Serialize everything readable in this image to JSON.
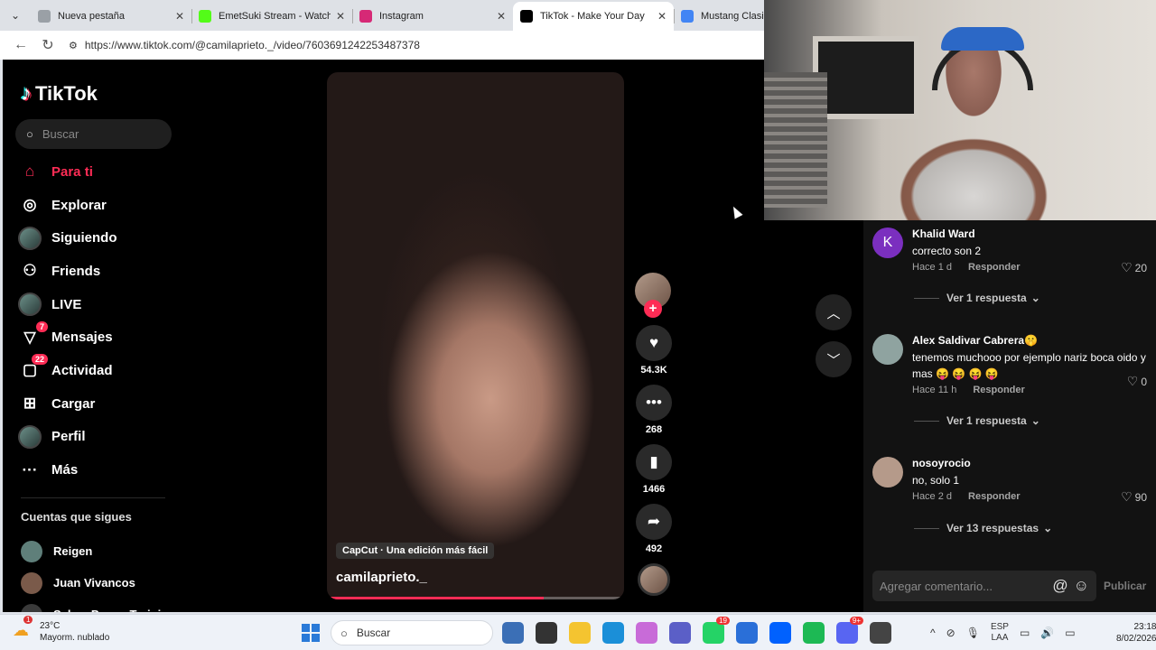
{
  "browser": {
    "tabs": [
      {
        "title": "Nueva pestaña",
        "favicon_color": "#9aa0a6",
        "active": false
      },
      {
        "title": "EmetSuki Stream - Watch Live",
        "favicon_color": "#53fc18",
        "active": false
      },
      {
        "title": "Instagram",
        "favicon_color": "#d62976",
        "active": false
      },
      {
        "title": "TikTok - Make Your Day",
        "favicon_color": "#000000",
        "active": true
      },
      {
        "title": "Mustang Clasico",
        "favicon_color": "#4285f4",
        "active": false
      }
    ],
    "url": "https://www.tiktok.com/@camilaprieto._/video/7603691242253487378"
  },
  "tiktok": {
    "brand": "TikTok",
    "search_placeholder": "Buscar",
    "nav": [
      {
        "label": "Para ti",
        "icon": "home-icon",
        "active": true
      },
      {
        "label": "Explorar",
        "icon": "compass-icon"
      },
      {
        "label": "Siguiendo",
        "icon": "following-avatar"
      },
      {
        "label": "Friends",
        "icon": "friends-icon"
      },
      {
        "label": "LIVE",
        "icon": "live-avatar"
      },
      {
        "label": "Mensajes",
        "icon": "messages-icon",
        "badge": "7"
      },
      {
        "label": "Actividad",
        "icon": "activity-icon",
        "badge": "22"
      },
      {
        "label": "Cargar",
        "icon": "upload-icon"
      },
      {
        "label": "Perfil",
        "icon": "profile-avatar"
      },
      {
        "label": "Más",
        "icon": "more-icon"
      }
    ],
    "following_title": "Cuentas que sigues",
    "following": [
      {
        "name": "Reigen"
      },
      {
        "name": "Juan Vivancos"
      },
      {
        "name": "Sebas Power Training"
      }
    ],
    "video": {
      "capcut_tag": "CapCut · Una edición más fácil",
      "author": "camilaprieto._",
      "progress": 0.73
    },
    "actions": {
      "likes": "54.3K",
      "comments": "268",
      "saves": "1466",
      "shares": "492"
    },
    "comments": [
      {
        "author": "Khalid Ward",
        "avatar_letter": "K",
        "avatar_color": "#7b2fbf",
        "text": "correcto son 2",
        "time": "Hace 1 d",
        "reply_label": "Responder",
        "likes": "20",
        "view_replies": "Ver 1 respuesta"
      },
      {
        "author": "Alex Saldivar Cabrera🤫",
        "avatar_letter": "",
        "avatar_color": "#8fa3a0",
        "text": "tenemos muchooo por ejemplo nariz boca oido y mas 😝 😝 😝 😝",
        "time": "Hace 11 h",
        "reply_label": "Responder",
        "likes": "0",
        "view_replies": "Ver 1 respuesta"
      },
      {
        "author": "nosoyrocio",
        "avatar_letter": "",
        "avatar_color": "#b59a8a",
        "text": "no, solo 1",
        "time": "Hace 2 d",
        "reply_label": "Responder",
        "likes": "90",
        "view_replies": "Ver 13 respuestas"
      }
    ],
    "comment_placeholder": "Agregar comentario...",
    "post_label": "Publicar"
  },
  "taskbar": {
    "weather_temp": "23°C",
    "weather_desc": "Mayorm. nublado",
    "weather_badge": "1",
    "search_placeholder": "Buscar",
    "apps": [
      {
        "name": "weather-widget-icon",
        "color": "#3b6fb6"
      },
      {
        "name": "terminal-icon",
        "color": "#333333"
      },
      {
        "name": "file-explorer-icon",
        "color": "#f4c430"
      },
      {
        "name": "edge-icon",
        "color": "#1b8fd8"
      },
      {
        "name": "copilot-icon",
        "color": "#c86bd8"
      },
      {
        "name": "teams-icon",
        "color": "#5b5fc7"
      },
      {
        "name": "whatsapp-icon",
        "color": "#25d366",
        "badge": "19"
      },
      {
        "name": "store-icon",
        "color": "#2a6fd8"
      },
      {
        "name": "dropbox-icon",
        "color": "#0061fe"
      },
      {
        "name": "spotify-icon",
        "color": "#1db954"
      },
      {
        "name": "discord-icon",
        "color": "#5865f2",
        "badge": "9+"
      },
      {
        "name": "app-icon",
        "color": "#444444"
      }
    ],
    "lang_line1": "ESP",
    "lang_line2": "LAA",
    "time": "23:18",
    "date": "8/02/2026"
  }
}
